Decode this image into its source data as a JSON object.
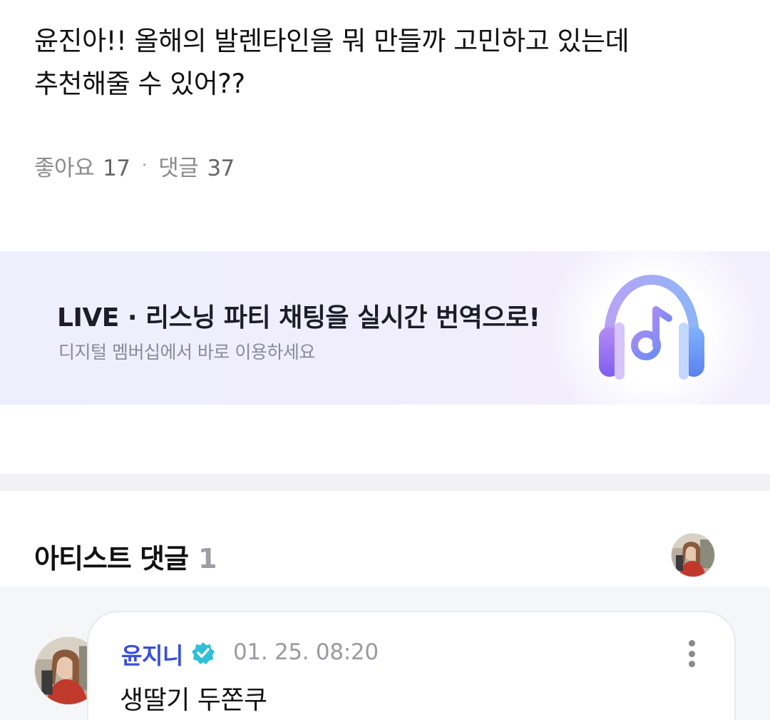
{
  "post": {
    "text_line1": "윤진아!! 올해의 발렌타인을 뭐 만들까 고민하고 있는데",
    "text_line2": "추천해줄 수 있어??",
    "likes_label": "좋아요",
    "likes_count": "17",
    "separator": "·",
    "comments_label": "댓글",
    "comments_count": "37"
  },
  "banner": {
    "title": "LIVE · 리스닝 파티 채팅을 실시간 번역으로!",
    "subtitle": "디지털 멤버십에서 바로 이용하세요",
    "icon": "headphones-music-icon"
  },
  "artist_comments": {
    "title": "아티스트 댓글",
    "count": "1",
    "comments": [
      {
        "author": "윤지니",
        "verified": true,
        "timestamp": "01. 25. 08:20",
        "body": "생딸기 두쫀쿠"
      }
    ]
  },
  "colors": {
    "author_name": "#3a4fd8",
    "verified_badge": "#2fbfd6",
    "banner_bg": "#eeeffc"
  }
}
